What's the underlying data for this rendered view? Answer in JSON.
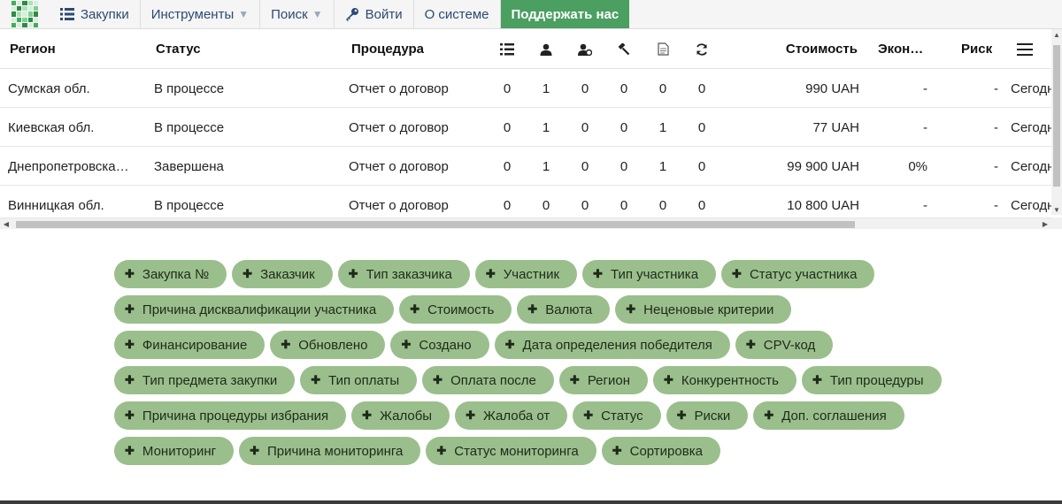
{
  "nav": {
    "items": [
      {
        "label": "Закупки",
        "icon": "list-icon",
        "caret": ""
      },
      {
        "label": "Инструменты",
        "icon": "",
        "caret": "▼"
      },
      {
        "label": "Поиск",
        "icon": "",
        "caret": "▼"
      },
      {
        "label": "Войти",
        "icon": "key-icon",
        "caret": ""
      },
      {
        "label": "О системе",
        "icon": "",
        "caret": ""
      }
    ],
    "support_label": "Поддержать нас"
  },
  "table": {
    "headers": {
      "region": "Регион",
      "status": "Статус",
      "procedure": "Процедура",
      "cost": "Стоимость",
      "economy": "Экон…",
      "risk": "Риск"
    },
    "icon_headers": [
      "list-icon",
      "person-icon",
      "person-dot-icon",
      "hammer-icon",
      "document-icon",
      "refresh-icon"
    ],
    "rows": [
      {
        "region": "Сумская обл.",
        "status": "В процессе",
        "procedure": "Отчет о договор",
        "counts": [
          "0",
          "1",
          "0",
          "0",
          "0",
          "0"
        ],
        "cost": "990 UAH",
        "economy": "-",
        "risk": "-",
        "date": "Сегодн"
      },
      {
        "region": "Киевская обл.",
        "status": "В процессе",
        "procedure": "Отчет о договор",
        "counts": [
          "0",
          "1",
          "0",
          "0",
          "1",
          "0"
        ],
        "cost": "77 UAH",
        "economy": "-",
        "risk": "-",
        "date": "Сегодн"
      },
      {
        "region": "Днепропетровска…",
        "status": "Завершена",
        "procedure": "Отчет о договор",
        "counts": [
          "0",
          "1",
          "0",
          "0",
          "1",
          "0"
        ],
        "cost": "99 900 UAH",
        "economy": "0%",
        "risk": "-",
        "date": "Сегодн"
      },
      {
        "region": "Винницкая обл.",
        "status": "В процессе",
        "procedure": "Отчет о договор",
        "counts": [
          "0",
          "0",
          "0",
          "0",
          "0",
          "0"
        ],
        "cost": "10 800 UAH",
        "economy": "-",
        "risk": "-",
        "date": "Сегодн"
      }
    ]
  },
  "pill_rows": [
    [
      "Закупка №",
      "Заказчик",
      "Тип заказчика",
      "Участник",
      "Тип участника",
      "Статус участника"
    ],
    [
      "Причина дисквалификации участника",
      "Стоимость",
      "Валюта",
      "Неценовые критерии"
    ],
    [
      "Финансирование",
      "Обновлено",
      "Создано",
      "Дата определения победителя",
      "CPV-код"
    ],
    [
      "Тип предмета закупки",
      "Тип оплаты",
      "Оплата после",
      "Регион",
      "Конкурентность",
      "Тип процедуры"
    ],
    [
      "Причина процедуры избрания",
      "Жалобы",
      "Жалоба от",
      "Статус",
      "Риски",
      "Доп. соглашения"
    ],
    [
      "Мониторинг",
      "Причина мониторинга",
      "Статус мониторинга",
      "Сортировка"
    ]
  ],
  "colors": {
    "accent": "#4b9f61",
    "pill": "#9bbf8c",
    "nav_text": "#2b4a73"
  }
}
